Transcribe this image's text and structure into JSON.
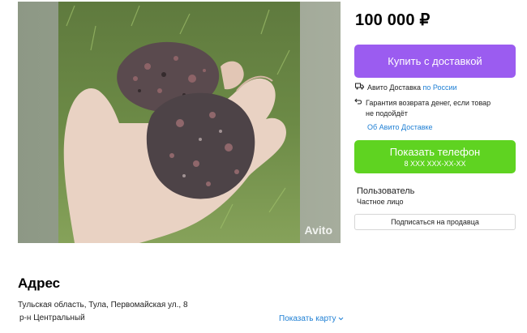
{
  "listing": {
    "price": "100 000 ₽",
    "photo_watermark": "Avito"
  },
  "actions": {
    "buy_label": "Купить с доставкой",
    "buy_color": "#9b5cf0",
    "phone_label": "Показать телефон",
    "phone_number": "8 XXX XXX-XX-XX",
    "phone_color": "#5fd321",
    "subscribe_label": "Подписаться на продавца"
  },
  "delivery": {
    "service_text": "Авито Доставка",
    "service_link": "по России",
    "guarantee_text": "Гарантия возврата денег, если товар не подойдёт",
    "about_link": "Об Авито Доставке"
  },
  "seller": {
    "name": "Пользователь",
    "type": "Частное лицо"
  },
  "address": {
    "heading": "Адрес",
    "line": "Тульская область, Тула, Первомайская ул., 8",
    "district": "р-н Центральный",
    "show_map": "Показать карту"
  },
  "icons": {
    "truck": "truck-icon",
    "return": "return-arrow-icon",
    "chevron": "chevron-down-icon"
  }
}
